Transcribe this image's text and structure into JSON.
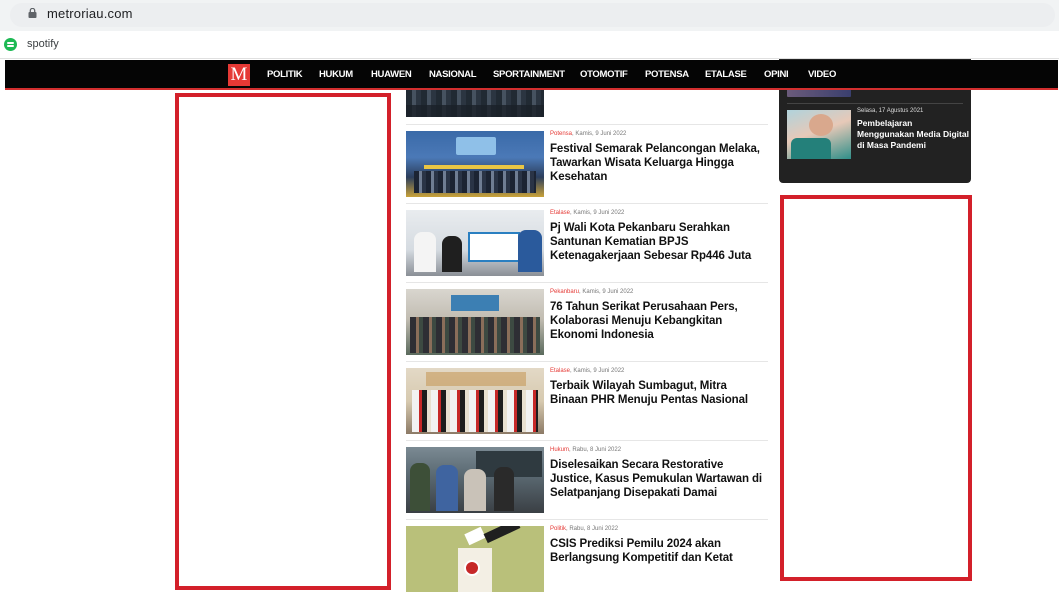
{
  "browser": {
    "url": "metroriau.com",
    "bookmark": {
      "label": "spotify",
      "icon": "spotify-icon"
    }
  },
  "nav": {
    "logo": "M",
    "items": [
      "POLITIK",
      "HUKUM",
      "HUAWEN",
      "NASIONAL",
      "SPORTAINMENT",
      "OTOMOTIF",
      "POTENSA",
      "ETALASE",
      "OPINI",
      "VIDEO"
    ]
  },
  "sidebar": {
    "article": {
      "date": "Selasa, 17 Agustus 2021",
      "title": "Pembelajaran Menggunakan Media Digital di Masa Pandemi"
    }
  },
  "articles": [
    {
      "category": "Potensa",
      "date": ", Kamis, 9 Juni 2022",
      "title": "Festival Semarak Pelancongan Melaka, Tawarkan Wisata Keluarga Hingga Kesehatan"
    },
    {
      "category": "Etalase",
      "date": ", Kamis, 9 Juni 2022",
      "title": "Pj Wali Kota Pekanbaru Serahkan Santunan Kematian BPJS Ketenagakerjaan Sebesar Rp446 Juta"
    },
    {
      "category": "Pekanbaru",
      "date": ", Kamis, 9 Juni 2022",
      "title": "76 Tahun Serikat Perusahaan Pers, Kolaborasi Menuju Kebangkitan Ekonomi Indonesia"
    },
    {
      "category": "Etalase",
      "date": ", Kamis, 9 Juni 2022",
      "title": "Terbaik Wilayah Sumbagut, Mitra Binaan PHR Menuju Pentas Nasional"
    },
    {
      "category": "Hukum",
      "date": ", Rabu, 8 Juni 2022",
      "title": "Diselesaikan Secara Restorative Justice, Kasus Pemukulan Wartawan di Selatpanjang Disepakati Damai"
    },
    {
      "category": "Politik",
      "date": ", Rabu, 8 Juni 2022",
      "title": "CSIS Prediksi Pemilu 2024 akan Berlangsung Kompetitif dan Ketat"
    }
  ]
}
